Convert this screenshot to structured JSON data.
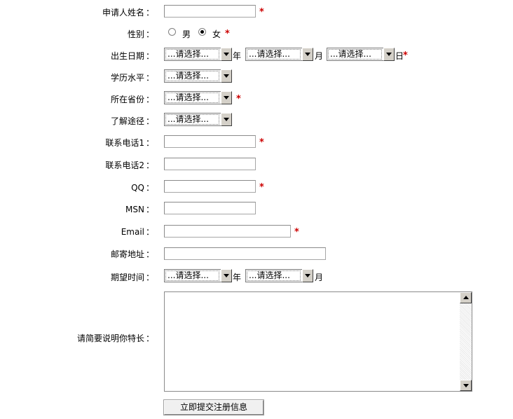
{
  "colon": "：",
  "required_mark": "*",
  "select_placeholder": "...请选择...",
  "fields": {
    "name": {
      "label": "申请人姓名",
      "value": ""
    },
    "gender": {
      "label": "性别",
      "options": [
        "男",
        "女"
      ],
      "selected": "女"
    },
    "birthdate": {
      "label": "出生日期",
      "unit_year": "年",
      "unit_month": "月",
      "unit_day": "日"
    },
    "education": {
      "label": "学历水平"
    },
    "province": {
      "label": "所在省份"
    },
    "channel": {
      "label": "了解途径"
    },
    "phone1": {
      "label": "联系电话1",
      "value": ""
    },
    "phone2": {
      "label": "联系电话2",
      "value": ""
    },
    "qq": {
      "label": "QQ",
      "value": ""
    },
    "msn": {
      "label": "MSN",
      "value": ""
    },
    "email": {
      "label": "Email",
      "value": ""
    },
    "address": {
      "label": "邮寄地址",
      "value": ""
    },
    "expected_time": {
      "label": "期望时间",
      "unit_year": "年",
      "unit_month": "月"
    },
    "specialty": {
      "label": "请简要说明你特长",
      "value": ""
    }
  },
  "submit_label": "立即提交注册信息",
  "colors": {
    "required": "#cc0000"
  }
}
